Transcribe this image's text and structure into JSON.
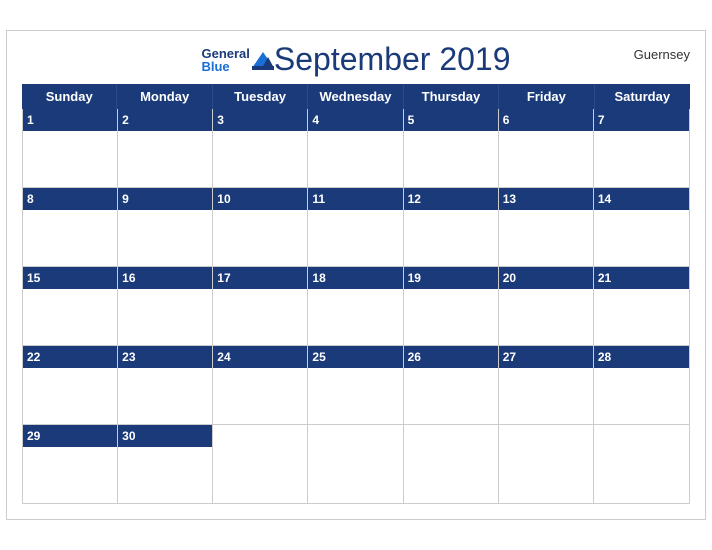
{
  "header": {
    "title": "September 2019",
    "region": "Guernsey",
    "logo_general": "General",
    "logo_blue": "Blue"
  },
  "days_of_week": [
    "Sunday",
    "Monday",
    "Tuesday",
    "Wednesday",
    "Thursday",
    "Friday",
    "Saturday"
  ],
  "weeks": [
    [
      {
        "num": "1",
        "empty": false
      },
      {
        "num": "2",
        "empty": false
      },
      {
        "num": "3",
        "empty": false
      },
      {
        "num": "4",
        "empty": false
      },
      {
        "num": "5",
        "empty": false
      },
      {
        "num": "6",
        "empty": false
      },
      {
        "num": "7",
        "empty": false
      }
    ],
    [
      {
        "num": "8",
        "empty": false
      },
      {
        "num": "9",
        "empty": false
      },
      {
        "num": "10",
        "empty": false
      },
      {
        "num": "11",
        "empty": false
      },
      {
        "num": "12",
        "empty": false
      },
      {
        "num": "13",
        "empty": false
      },
      {
        "num": "14",
        "empty": false
      }
    ],
    [
      {
        "num": "15",
        "empty": false
      },
      {
        "num": "16",
        "empty": false
      },
      {
        "num": "17",
        "empty": false
      },
      {
        "num": "18",
        "empty": false
      },
      {
        "num": "19",
        "empty": false
      },
      {
        "num": "20",
        "empty": false
      },
      {
        "num": "21",
        "empty": false
      }
    ],
    [
      {
        "num": "22",
        "empty": false
      },
      {
        "num": "23",
        "empty": false
      },
      {
        "num": "24",
        "empty": false
      },
      {
        "num": "25",
        "empty": false
      },
      {
        "num": "26",
        "empty": false
      },
      {
        "num": "27",
        "empty": false
      },
      {
        "num": "28",
        "empty": false
      }
    ],
    [
      {
        "num": "29",
        "empty": false
      },
      {
        "num": "30",
        "empty": false
      },
      {
        "num": "",
        "empty": true
      },
      {
        "num": "",
        "empty": true
      },
      {
        "num": "",
        "empty": true
      },
      {
        "num": "",
        "empty": true
      },
      {
        "num": "",
        "empty": true
      }
    ]
  ]
}
